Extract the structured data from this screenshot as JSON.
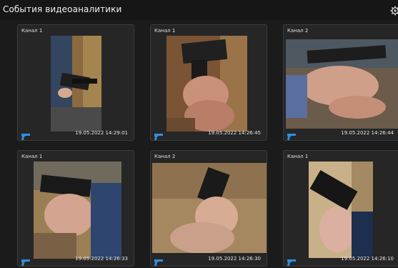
{
  "window": {
    "title": "События видеоаналитики"
  },
  "icons": {
    "settings": "gear-icon",
    "event_type": "pistol-icon"
  },
  "colors": {
    "accent": "#2f8fe0",
    "background": "#1b1b1b",
    "card": "#262626"
  },
  "events": [
    {
      "channel": "Канал 1",
      "timestamp": "19.05.2022 14:29:01"
    },
    {
      "channel": "Канал 1",
      "timestamp": "19.05.2022 14:26:45"
    },
    {
      "channel": "Канал 2",
      "timestamp": "19.05.2022 14:26:44"
    },
    {
      "channel": "Канал 1",
      "timestamp": "19.05.2022 14:26:33"
    },
    {
      "channel": "Канал 2",
      "timestamp": "19.05.2022 14:26:30"
    },
    {
      "channel": "Канал 1",
      "timestamp": "19.05.2022 14:26:10"
    }
  ]
}
